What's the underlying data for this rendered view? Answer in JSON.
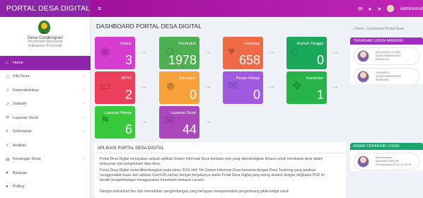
{
  "app": {
    "brand": "PORTAL DESA DIGITAL"
  },
  "topbar": {
    "user": "Administrat",
    "icons": [
      "menu-icon",
      "mail-icon",
      "chat-icon",
      "pin-icon"
    ]
  },
  "sidebar": {
    "village_name": "Desa Condongsari",
    "village_district": "Kecamatan Banyuurip",
    "village_regency": "Kabupaten Purworejo",
    "items": [
      {
        "label": "Home",
        "icon": "home-icon",
        "active": true,
        "chevron": false
      },
      {
        "label": "Info Desa",
        "icon": "info-icon",
        "active": false,
        "chevron": true
      },
      {
        "label": "Kependudukan",
        "icon": "people-icon",
        "active": false,
        "chevron": true
      },
      {
        "label": "Statistik",
        "icon": "chart-icon",
        "active": false,
        "chevron": true
      },
      {
        "label": "Layanan Surat",
        "icon": "mail-icon",
        "active": false,
        "chevron": true
      },
      {
        "label": "Sekretariat",
        "icon": "document-icon",
        "active": false,
        "chevron": true
      },
      {
        "label": "Analisis",
        "icon": "check-icon",
        "active": false,
        "chevron": false
      },
      {
        "label": "Keuangan Desa",
        "icon": "money-icon",
        "active": false,
        "chevron": true
      },
      {
        "label": "Bantuan",
        "icon": "heart-icon",
        "active": false,
        "chevron": false
      },
      {
        "label": "Polling",
        "icon": "poll-icon",
        "active": false,
        "chevron": false
      },
      {
        "label": "Pertanahan",
        "icon": "map-icon",
        "active": false,
        "chevron": false
      }
    ]
  },
  "main": {
    "title": "DASHBOARD PORTAL DESA DIGITAL",
    "breadcrumb": "⌂ Home › Dashboard Portal Desa",
    "cards": [
      {
        "label": "Dusun",
        "value": "3",
        "color": "#d63cd0",
        "icon": "location-icon"
      },
      {
        "label": "Penduduk",
        "value": "1978",
        "color": "#4caf50",
        "icon": "person-icon"
      },
      {
        "label": "Keluarga",
        "value": "658",
        "color": "#f06a45",
        "icon": "family-icon"
      },
      {
        "label": "Rumah Tangga",
        "value": "0",
        "color": "#1aa95a",
        "icon": "house-icon"
      },
      {
        "label": "BPNT",
        "value": "2",
        "color": "#ec3f5c",
        "icon": "card-icon"
      },
      {
        "label": "Kelompok",
        "value": "0",
        "color": "#f7a13a",
        "icon": "group-icon"
      },
      {
        "label": "Pesan Warga",
        "value": "0",
        "color": "#a05ae0",
        "icon": "message-icon"
      },
      {
        "label": "Komentar",
        "value": "1",
        "color": "#27b34a",
        "icon": "comment-icon"
      },
      {
        "label": "Laporan Warga",
        "value": "6",
        "color": "#38c93c",
        "icon": "report-icon"
      },
      {
        "label": "Layanan Surat",
        "value": "44",
        "color": "#ab47bc",
        "icon": "letter-icon"
      }
    ]
  },
  "right_panels": {
    "login_title": "TERAKHIR LOGIN MANDIRI",
    "login_entries": [
      {
        "name": "NAUFA AFLIH SAFI",
        "id": "3306070605940003",
        "status": "BERHASIL"
      },
      {
        "name": "SUPRAPTI",
        "id": "3306070605930003",
        "status": "BERHASIL"
      }
    ],
    "admin_title": "ADMIN TERAKHIR LOGIN",
    "admin_entry": {
      "name": "Administrator",
      "role": "ADMINISTRATOR",
      "time": "04 November 2021 11:16:15"
    }
  },
  "info": {
    "title": "APLIKASI PORTAL DESA DIGITAL",
    "paragraphs": [
      "Portal Desa Digital merupakan sebuah aplikasi Sistem Informasi Desa berbasis web yang dikembangkan khusus untuk membantu desa dalam pelayanan dan pengelolaan data desa.",
      "Portal Desa Digital mulai dikembangkan pada tahun 2019 oleh Tim Sistem Informasi Desa bersama dengan Desa Tambong yang awalnya menggunakan basis dari aplikasi OpenSID namun dengan berjalannya waktu Portal Desa Digital yang sering disebut dengan singkatan PDD ini beralih pengembangan menggunakan framework berbasis Laravel.",
      "Dengan kebutuhan fitur dan kemudahan pengembangan yang bertujuan mempermudah pengembang pihak ketiga untuk"
    ]
  }
}
